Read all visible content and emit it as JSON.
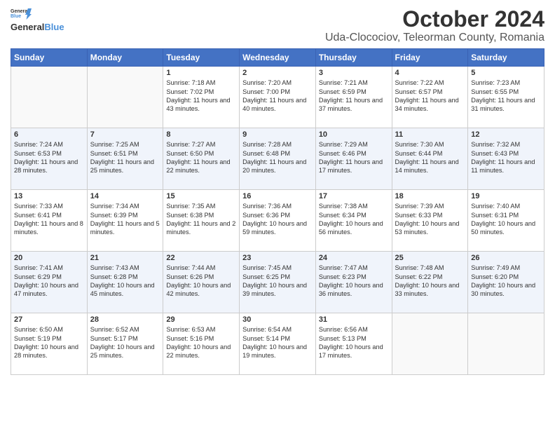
{
  "header": {
    "logo_line1": "General",
    "logo_line2": "Blue",
    "title": "October 2024",
    "subtitle": "Uda-Clocociov, Teleorman County, Romania"
  },
  "days_of_week": [
    "Sunday",
    "Monday",
    "Tuesday",
    "Wednesday",
    "Thursday",
    "Friday",
    "Saturday"
  ],
  "weeks": [
    [
      {
        "day": "",
        "info": ""
      },
      {
        "day": "",
        "info": ""
      },
      {
        "day": "1",
        "info": "Sunrise: 7:18 AM\nSunset: 7:02 PM\nDaylight: 11 hours and 43 minutes."
      },
      {
        "day": "2",
        "info": "Sunrise: 7:20 AM\nSunset: 7:00 PM\nDaylight: 11 hours and 40 minutes."
      },
      {
        "day": "3",
        "info": "Sunrise: 7:21 AM\nSunset: 6:59 PM\nDaylight: 11 hours and 37 minutes."
      },
      {
        "day": "4",
        "info": "Sunrise: 7:22 AM\nSunset: 6:57 PM\nDaylight: 11 hours and 34 minutes."
      },
      {
        "day": "5",
        "info": "Sunrise: 7:23 AM\nSunset: 6:55 PM\nDaylight: 11 hours and 31 minutes."
      }
    ],
    [
      {
        "day": "6",
        "info": "Sunrise: 7:24 AM\nSunset: 6:53 PM\nDaylight: 11 hours and 28 minutes."
      },
      {
        "day": "7",
        "info": "Sunrise: 7:25 AM\nSunset: 6:51 PM\nDaylight: 11 hours and 25 minutes."
      },
      {
        "day": "8",
        "info": "Sunrise: 7:27 AM\nSunset: 6:50 PM\nDaylight: 11 hours and 22 minutes."
      },
      {
        "day": "9",
        "info": "Sunrise: 7:28 AM\nSunset: 6:48 PM\nDaylight: 11 hours and 20 minutes."
      },
      {
        "day": "10",
        "info": "Sunrise: 7:29 AM\nSunset: 6:46 PM\nDaylight: 11 hours and 17 minutes."
      },
      {
        "day": "11",
        "info": "Sunrise: 7:30 AM\nSunset: 6:44 PM\nDaylight: 11 hours and 14 minutes."
      },
      {
        "day": "12",
        "info": "Sunrise: 7:32 AM\nSunset: 6:43 PM\nDaylight: 11 hours and 11 minutes."
      }
    ],
    [
      {
        "day": "13",
        "info": "Sunrise: 7:33 AM\nSunset: 6:41 PM\nDaylight: 11 hours and 8 minutes."
      },
      {
        "day": "14",
        "info": "Sunrise: 7:34 AM\nSunset: 6:39 PM\nDaylight: 11 hours and 5 minutes."
      },
      {
        "day": "15",
        "info": "Sunrise: 7:35 AM\nSunset: 6:38 PM\nDaylight: 11 hours and 2 minutes."
      },
      {
        "day": "16",
        "info": "Sunrise: 7:36 AM\nSunset: 6:36 PM\nDaylight: 10 hours and 59 minutes."
      },
      {
        "day": "17",
        "info": "Sunrise: 7:38 AM\nSunset: 6:34 PM\nDaylight: 10 hours and 56 minutes."
      },
      {
        "day": "18",
        "info": "Sunrise: 7:39 AM\nSunset: 6:33 PM\nDaylight: 10 hours and 53 minutes."
      },
      {
        "day": "19",
        "info": "Sunrise: 7:40 AM\nSunset: 6:31 PM\nDaylight: 10 hours and 50 minutes."
      }
    ],
    [
      {
        "day": "20",
        "info": "Sunrise: 7:41 AM\nSunset: 6:29 PM\nDaylight: 10 hours and 47 minutes."
      },
      {
        "day": "21",
        "info": "Sunrise: 7:43 AM\nSunset: 6:28 PM\nDaylight: 10 hours and 45 minutes."
      },
      {
        "day": "22",
        "info": "Sunrise: 7:44 AM\nSunset: 6:26 PM\nDaylight: 10 hours and 42 minutes."
      },
      {
        "day": "23",
        "info": "Sunrise: 7:45 AM\nSunset: 6:25 PM\nDaylight: 10 hours and 39 minutes."
      },
      {
        "day": "24",
        "info": "Sunrise: 7:47 AM\nSunset: 6:23 PM\nDaylight: 10 hours and 36 minutes."
      },
      {
        "day": "25",
        "info": "Sunrise: 7:48 AM\nSunset: 6:22 PM\nDaylight: 10 hours and 33 minutes."
      },
      {
        "day": "26",
        "info": "Sunrise: 7:49 AM\nSunset: 6:20 PM\nDaylight: 10 hours and 30 minutes."
      }
    ],
    [
      {
        "day": "27",
        "info": "Sunrise: 6:50 AM\nSunset: 5:19 PM\nDaylight: 10 hours and 28 minutes."
      },
      {
        "day": "28",
        "info": "Sunrise: 6:52 AM\nSunset: 5:17 PM\nDaylight: 10 hours and 25 minutes."
      },
      {
        "day": "29",
        "info": "Sunrise: 6:53 AM\nSunset: 5:16 PM\nDaylight: 10 hours and 22 minutes."
      },
      {
        "day": "30",
        "info": "Sunrise: 6:54 AM\nSunset: 5:14 PM\nDaylight: 10 hours and 19 minutes."
      },
      {
        "day": "31",
        "info": "Sunrise: 6:56 AM\nSunset: 5:13 PM\nDaylight: 10 hours and 17 minutes."
      },
      {
        "day": "",
        "info": ""
      },
      {
        "day": "",
        "info": ""
      }
    ]
  ]
}
